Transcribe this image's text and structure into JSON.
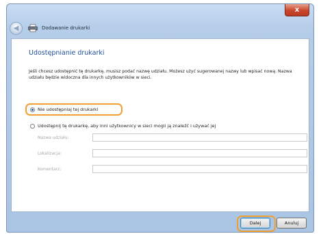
{
  "window": {
    "title": "Dodawanie drukarki",
    "close_glyph": "x",
    "back_glyph": "◀"
  },
  "icons": {
    "close": "close-icon",
    "back": "back-arrow-icon",
    "printer": "printer-icon"
  },
  "page": {
    "heading": "Udostępnianie drukarki",
    "description": "Jeśli chcesz udostępnić tę drukarkę, musisz podać nazwę udziału. Możesz użyć sugerowanej nazwy lub wpisać nową. Nazwa udziału będzie widoczna dla innych użytkowników w sieci."
  },
  "options": {
    "no_share": {
      "label": "Nie udostępniaj tej drukarki",
      "selected": true
    },
    "share": {
      "label": "Udostępnij tę drukarkę, aby inni użytkownicy w sieci mogli ją znaleźć i używać jej",
      "selected": false
    }
  },
  "fields": {
    "share_name": {
      "label": "Nazwa udziału:",
      "value": ""
    },
    "location": {
      "label": "Lokalizacja:",
      "value": ""
    },
    "comment": {
      "label": "Komentarz:",
      "value": ""
    }
  },
  "buttons": {
    "next": "Dalej",
    "cancel": "Anuluj"
  },
  "colors": {
    "highlight": "#f0a030",
    "heading": "#1f4f9c"
  }
}
